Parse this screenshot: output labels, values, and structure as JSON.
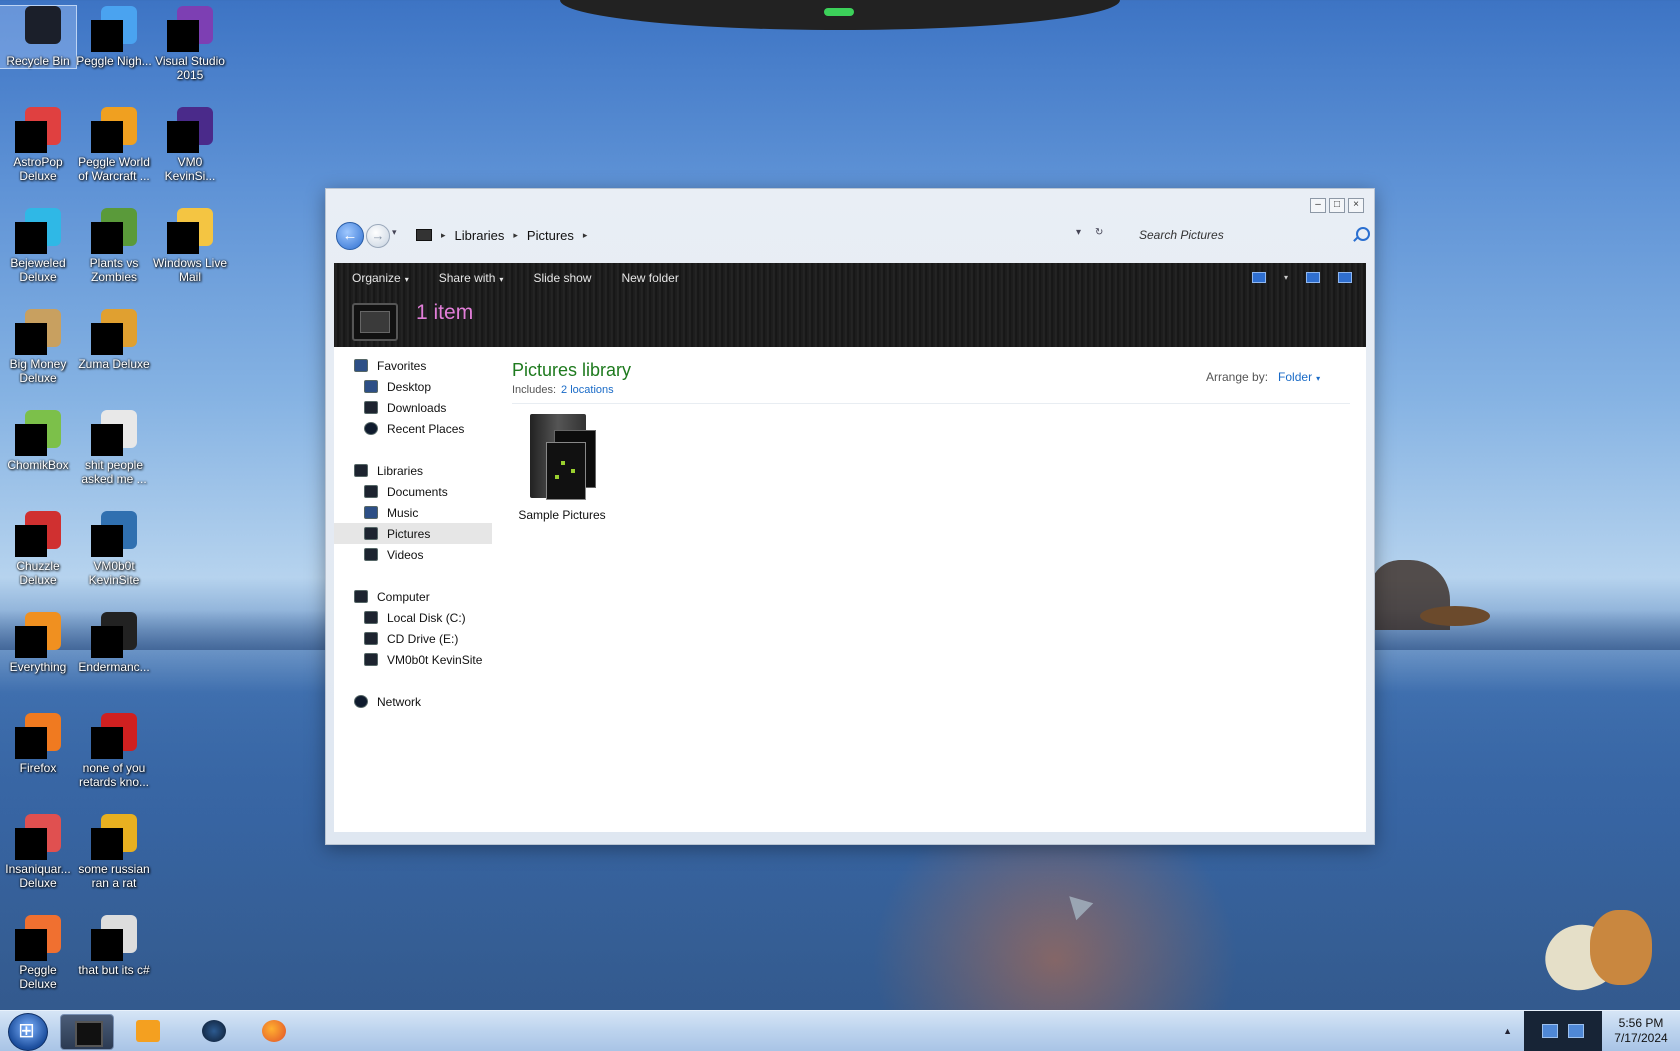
{
  "desktop": {
    "icons": [
      {
        "label": "Recycle Bin",
        "art": "#1b1f2a",
        "icon": "recycle-bin-icon"
      },
      {
        "label": "Peggle Nigh...",
        "art": "#4aa3f0",
        "icon": "peggle-nights-icon"
      },
      {
        "label": "Visual Studio 2015",
        "art": "#7d3fb3",
        "icon": "visual-studio-icon"
      },
      {
        "label": "AstroPop Deluxe",
        "art": "#e04040",
        "icon": "astropop-icon"
      },
      {
        "label": "Peggle World of Warcraft ...",
        "art": "#f0a020",
        "icon": "peggle-wow-icon"
      },
      {
        "label": "VM0 KevinSi...",
        "art": "#4a2a8a",
        "icon": "vm-icon"
      },
      {
        "label": "Bejeweled Deluxe",
        "art": "#2fb8e6",
        "icon": "bejeweled-icon"
      },
      {
        "label": "Plants vs Zombies",
        "art": "#5a9a3a",
        "icon": "pvz-icon"
      },
      {
        "label": "Windows Live Mail",
        "art": "#f4c542",
        "icon": "live-mail-icon"
      },
      {
        "label": "Big Money Deluxe",
        "art": "#c8a060",
        "icon": "big-money-icon"
      },
      {
        "label": "Zuma Deluxe",
        "art": "#e0a030",
        "icon": "zuma-icon"
      },
      {
        "label": "ChomikBox",
        "art": "#7cc04a",
        "icon": "chomikbox-icon"
      },
      {
        "label": "shit people asked me ...",
        "art": "#e8e8e8",
        "icon": "text-file-icon"
      },
      {
        "label": "Chuzzle Deluxe",
        "art": "#d03030",
        "icon": "chuzzle-icon"
      },
      {
        "label": "VM0b0t KevinSite",
        "art": "#3070b0",
        "icon": "vm-bot-icon"
      },
      {
        "label": "Everything",
        "art": "#f09020",
        "icon": "everything-icon"
      },
      {
        "label": "Endermanc...",
        "art": "#222222",
        "icon": "endermanch-icon"
      },
      {
        "label": "Firefox",
        "art": "#f07a20",
        "icon": "firefox-icon"
      },
      {
        "label": "none of you retards kno...",
        "art": "#d02020",
        "icon": "opera-icon"
      },
      {
        "label": "Insaniquar... Deluxe",
        "art": "#e05050",
        "icon": "insaniquarium-icon"
      },
      {
        "label": "some russian ran a rat",
        "art": "#e8b020",
        "icon": "ie-icon"
      },
      {
        "label": "Peggle Deluxe",
        "art": "#f07030",
        "icon": "peggle-icon"
      },
      {
        "label": "that but its c#",
        "art": "#dddddd",
        "icon": "files-icon"
      }
    ]
  },
  "window": {
    "controls": {
      "minimize": "–",
      "maximize": "□",
      "close": "×"
    },
    "nav": {
      "back": "←",
      "forward": "→",
      "dropdown": "▾"
    },
    "breadcrumb": [
      "Libraries",
      "Pictures"
    ],
    "crumb_sep": "▸",
    "search_placeholder": "Search Pictures",
    "address_tools": {
      "dropdown": "▾",
      "refresh": "↻"
    },
    "toolbar": {
      "organize": "Organize",
      "share_with": "Share with",
      "slide_show": "Slide show",
      "new_folder": "New folder",
      "caret": "▾"
    },
    "item_count": "1 item",
    "nav_pane": {
      "favorites": {
        "label": "Favorites",
        "items": [
          "Desktop",
          "Downloads",
          "Recent Places"
        ]
      },
      "libraries": {
        "label": "Libraries",
        "items": [
          "Documents",
          "Music",
          "Pictures",
          "Videos"
        ],
        "selected": "Pictures"
      },
      "computer": {
        "label": "Computer",
        "items": [
          "Local Disk (C:)",
          "CD Drive (E:)",
          "VM0b0t KevinSite"
        ]
      },
      "network": {
        "label": "Network"
      }
    },
    "library": {
      "title": "Pictures library",
      "includes_label": "Includes:",
      "includes_link": "2 locations",
      "arrange_label": "Arrange by:",
      "arrange_value": "Folder"
    },
    "folders": [
      {
        "name": "Sample Pictures"
      }
    ]
  },
  "taskbar": {
    "tray_arrow": "▲",
    "time": "5:56 PM",
    "date": "7/17/2024"
  }
}
